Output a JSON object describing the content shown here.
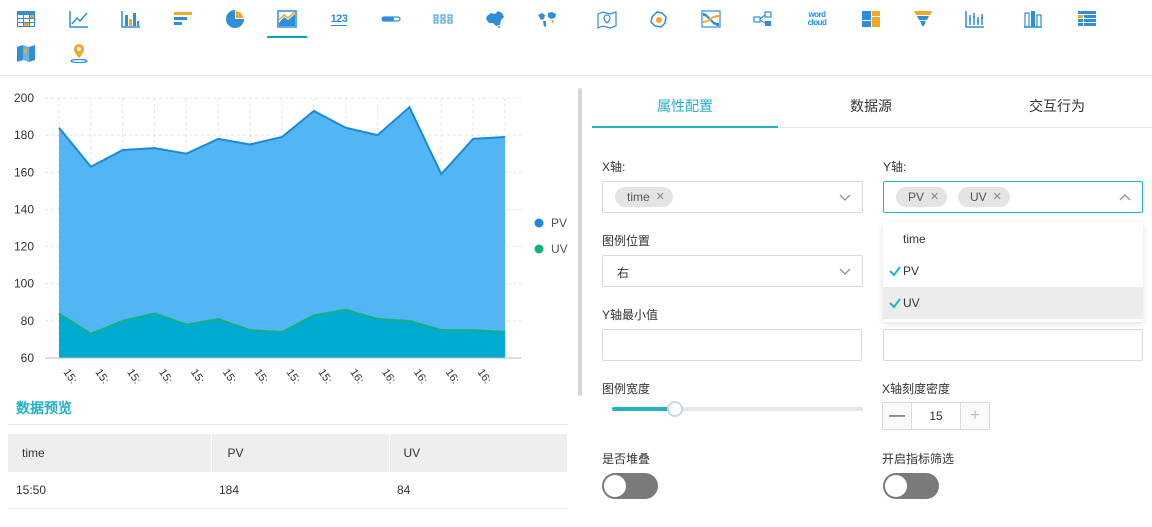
{
  "toolbar": {
    "num_icon_label": "123",
    "wordcloud_line1": "word",
    "wordcloud_line2": "cloud"
  },
  "chart_data": {
    "type": "area",
    "categories": [
      "15:",
      "15:",
      "15:",
      "15:",
      "15:",
      "15:",
      "15:",
      "15:",
      "15:",
      "16:",
      "16:",
      "16:",
      "16:",
      "16:"
    ],
    "series": [
      {
        "name": "PV",
        "values": [
          184,
          163,
          172,
          173,
          170,
          178,
          175,
          179,
          193,
          184,
          180,
          195,
          159,
          178,
          179
        ],
        "color": "#52b6f5",
        "line": "#1a8ad8"
      },
      {
        "name": "UV",
        "values": [
          84,
          73,
          80,
          84,
          78,
          81,
          75,
          74,
          83,
          86,
          81,
          80,
          75,
          75,
          74
        ],
        "color": "#00abd1",
        "line": "#12b27a"
      }
    ],
    "x_tick_labels": [
      "15:",
      "15:",
      "15:",
      "15:",
      "15:",
      "15:",
      "15:",
      "15:",
      "15:",
      "16:",
      "16:",
      "16:",
      "16:",
      "16:"
    ],
    "y_ticks": [
      60,
      80,
      100,
      120,
      140,
      160,
      180,
      200
    ],
    "ylim": [
      60,
      200
    ],
    "grid": true,
    "legend_position": "right",
    "legend": [
      {
        "label": "PV",
        "color": "#1a8ad8"
      },
      {
        "label": "UV",
        "color": "#12b27a"
      }
    ]
  },
  "preview": {
    "title": "数据预览",
    "columns": [
      "time",
      "PV",
      "UV"
    ],
    "rows": [
      [
        "15:50",
        "184",
        "84"
      ]
    ]
  },
  "tabs": [
    {
      "label": "属性配置",
      "active": true
    },
    {
      "label": "数据源",
      "active": false
    },
    {
      "label": "交互行为",
      "active": false
    }
  ],
  "config": {
    "x_axis_label": "X轴:",
    "x_axis_chips": [
      "time"
    ],
    "y_axis_label": "Y轴:",
    "y_axis_chips": [
      "PV",
      "UV"
    ],
    "legend_pos_label": "图例位置",
    "legend_pos_value": "右",
    "y_min_label": "Y轴最小值",
    "legend_width_label": "图例宽度",
    "legend_width_fraction": 0.25,
    "x_density_label": "X轴刻度密度",
    "x_density_value": "15",
    "stack_label": "是否堆叠",
    "stack_on": false,
    "filter_label": "开启指标筛选",
    "filter_on": false
  },
  "dropdown": {
    "options": [
      {
        "label": "time",
        "checked": false
      },
      {
        "label": "PV",
        "checked": true
      },
      {
        "label": "UV",
        "checked": true
      }
    ]
  },
  "colors": {
    "accent": "#22b2c8",
    "check": "#22b2c8"
  }
}
